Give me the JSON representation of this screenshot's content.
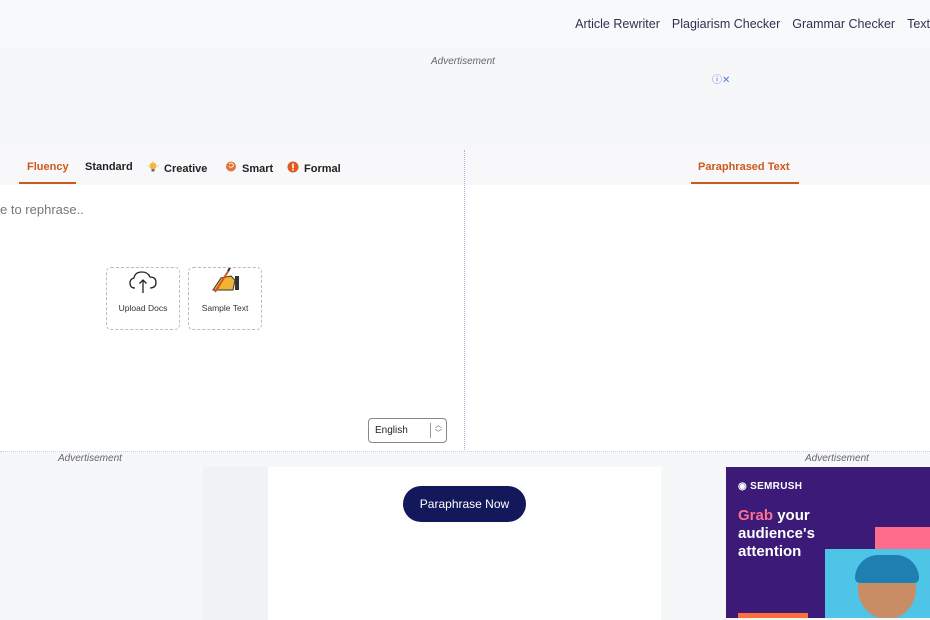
{
  "nav": {
    "links": [
      "Article Rewriter",
      "Plagiarism Checker",
      "Grammar Checker",
      "Text"
    ]
  },
  "ads": {
    "top_label": "Advertisement",
    "left_label": "Advertisement",
    "right_label": "Advertisement",
    "info_icon": "ⓘ✕"
  },
  "modes": {
    "tabs": [
      {
        "label": "Fluency",
        "icon": null,
        "active": true
      },
      {
        "label": "Standard",
        "icon": null,
        "active": false
      },
      {
        "label": "Creative",
        "icon": "lightbulb-icon",
        "active": false
      },
      {
        "label": "Smart",
        "icon": "brain-icon",
        "active": false
      },
      {
        "label": "Formal",
        "icon": "alert-icon",
        "active": false
      }
    ]
  },
  "output": {
    "tab_label": "Paraphrased Text"
  },
  "input": {
    "placeholder": "e to rephrase..",
    "upload_label": "Upload Docs",
    "sample_label": "Sample Text"
  },
  "language": {
    "selected": "English"
  },
  "cta": {
    "label": "Paraphrase Now"
  },
  "ad_banner": {
    "brand": "SEMRUSH",
    "headline_highlight": "Grab",
    "headline_rest_1": "your",
    "headline_rest_2": "audience's",
    "headline_rest_3": "attention"
  },
  "colors": {
    "accent": "#d0571c",
    "cta_bg": "#12185a",
    "ad_bg": "#3b1a78"
  }
}
